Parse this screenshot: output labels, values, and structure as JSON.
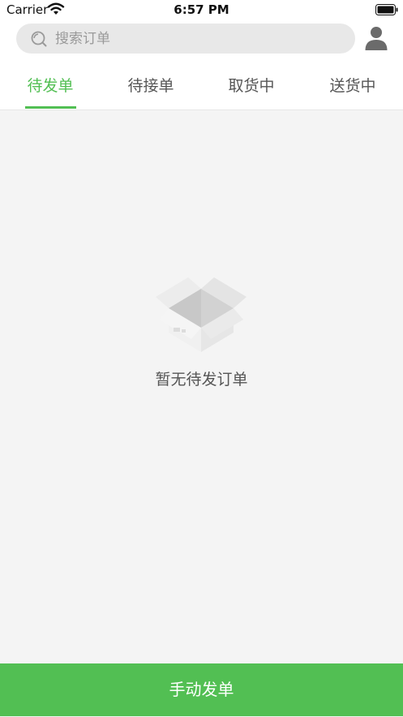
{
  "status_bar": {
    "carrier": "Carrier",
    "time": "6:57 PM",
    "icons": [
      "wifi-icon",
      "battery-icon"
    ]
  },
  "search": {
    "placeholder": "搜索订单",
    "value": "",
    "icon": "search-icon"
  },
  "profile": {
    "icon": "user-icon"
  },
  "tabs": [
    {
      "label": "待发单",
      "active": true
    },
    {
      "label": "待接单",
      "active": false
    },
    {
      "label": "取货中",
      "active": false
    },
    {
      "label": "送货中",
      "active": false
    }
  ],
  "empty_state": {
    "icon": "empty-box-icon",
    "message": "暂无待发订单"
  },
  "bottom_action": {
    "label": "手动发单"
  },
  "colors": {
    "accent": "#52bf53",
    "background": "#f4f4f4",
    "search_bg": "#e8e8e8",
    "text": "#555555"
  }
}
